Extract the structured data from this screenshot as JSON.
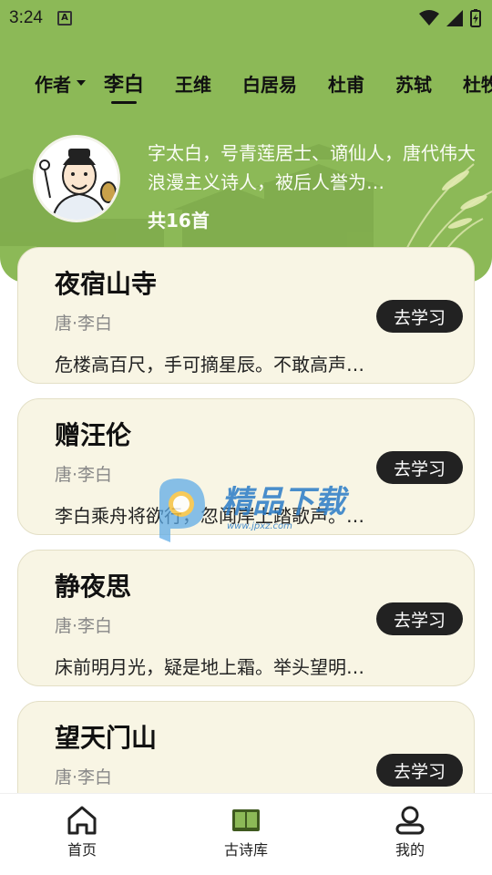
{
  "status_bar": {
    "time": "3:24",
    "notif_icon": "A"
  },
  "tabs": {
    "author_dropdown": "作者",
    "items": [
      "李白",
      "王维",
      "白居易",
      "杜甫",
      "苏轼",
      "杜牧"
    ],
    "active_index": 0
  },
  "author": {
    "intro": "字太白，号青莲居士、谪仙人，唐代伟大浪漫主义诗人，被后人誉为…",
    "count": "共16首"
  },
  "poems": [
    {
      "title": "夜宿山寺",
      "author": "唐·李白",
      "excerpt": "危楼高百尺，手可摘星辰。不敢高声…",
      "button": "去学习"
    },
    {
      "title": "赠汪伦",
      "author": "唐·李白",
      "excerpt": "李白乘舟将欲行，忽闻岸上踏歌声。…",
      "button": "去学习"
    },
    {
      "title": "静夜思",
      "author": "唐·李白",
      "excerpt": "床前明月光，疑是地上霜。举头望明…",
      "button": "去学习"
    },
    {
      "title": "望天门山",
      "author": "唐·李白",
      "excerpt": "",
      "button": "去学习"
    }
  ],
  "watermark": {
    "text": "精品下载",
    "url": "www.jpxz.com"
  },
  "bottom_nav": {
    "items": [
      {
        "label": "首页",
        "icon": "home-icon"
      },
      {
        "label": "古诗库",
        "icon": "book-icon"
      },
      {
        "label": "我的",
        "icon": "profile-icon"
      }
    ],
    "active_index": 1
  },
  "colors": {
    "header_green": "#8cb957",
    "card_bg": "#f8f5e4",
    "button_dark": "#222222"
  }
}
